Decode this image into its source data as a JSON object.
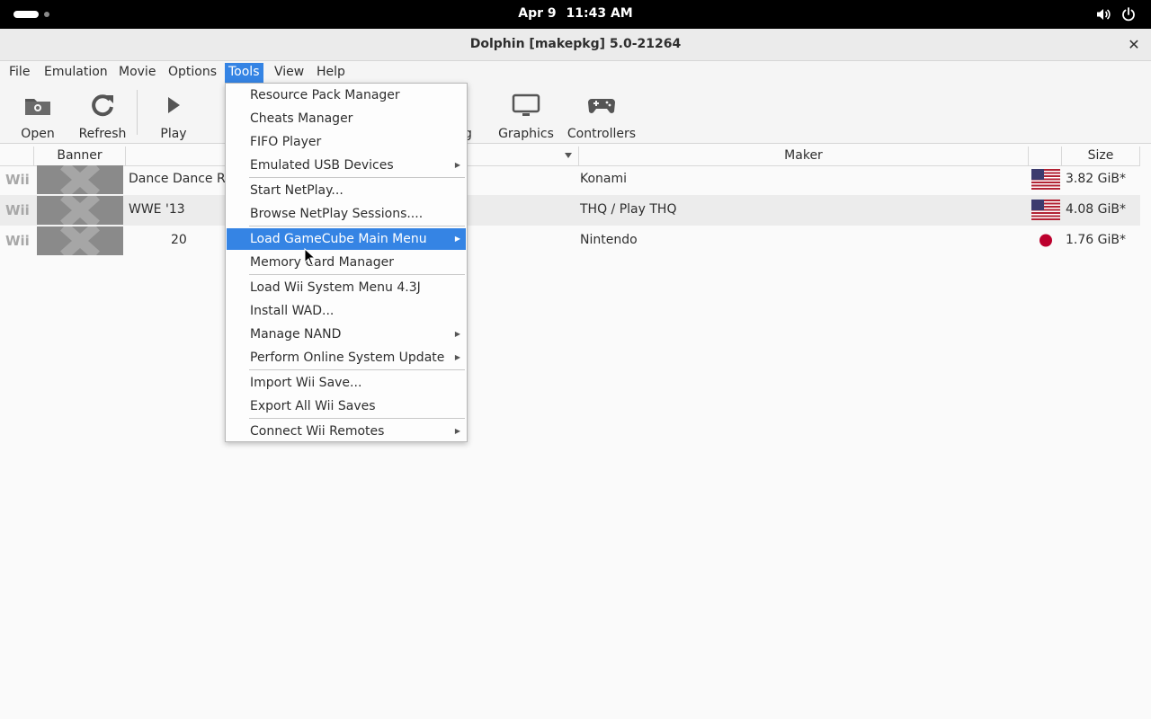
{
  "topbar": {
    "date": "Apr 9",
    "time": "11:43 AM",
    "icons": [
      "activities-pill-icon",
      "workspace-dot-icon",
      "volume-icon",
      "power-icon"
    ]
  },
  "window": {
    "title": "Dolphin [makepkg] 5.0-21264",
    "close_glyph": "✕"
  },
  "menubar": {
    "items": [
      "File",
      "Emulation",
      "Movie",
      "Options",
      "Tools",
      "View",
      "Help"
    ],
    "active": "Tools"
  },
  "toolbar": {
    "open": "Open",
    "refresh": "Refresh",
    "play": "Play",
    "config_partial": "g",
    "graphics": "Graphics",
    "controllers": "Controllers"
  },
  "table": {
    "headers": {
      "banner": "Banner",
      "maker": "Maker",
      "size": "Size"
    },
    "rows": [
      {
        "platform": "Wii",
        "title": "Dance Dance Re",
        "maker": "Konami",
        "region": "USA",
        "size": "3.82 GiB*"
      },
      {
        "platform": "Wii",
        "title": "WWE '13",
        "maker": "THQ / Play THQ",
        "region": "USA",
        "size": "4.08 GiB*"
      },
      {
        "platform": "Wii",
        "title": "20",
        "maker": "Nintendo",
        "region": "Japan",
        "size": "1.76 GiB*"
      }
    ]
  },
  "tools_menu": {
    "items": [
      {
        "label": "Resource Pack Manager",
        "submenu": false
      },
      {
        "label": "Cheats Manager",
        "submenu": false
      },
      {
        "label": "FIFO Player",
        "submenu": false
      },
      {
        "label": "Emulated USB Devices",
        "submenu": true
      },
      {
        "label": "Start NetPlay...",
        "submenu": false
      },
      {
        "label": "Browse NetPlay Sessions....",
        "submenu": false
      },
      {
        "label": "Load GameCube Main Menu",
        "submenu": true,
        "highlighted": true
      },
      {
        "label": "Memory Card Manager",
        "submenu": false
      },
      {
        "label": "Load Wii System Menu 4.3J",
        "submenu": false
      },
      {
        "label": "Install WAD...",
        "submenu": false
      },
      {
        "label": "Manage NAND",
        "submenu": true
      },
      {
        "label": "Perform Online System Update",
        "submenu": true
      },
      {
        "label": "Import Wii Save...",
        "submenu": false
      },
      {
        "label": "Export All Wii Saves",
        "submenu": false
      },
      {
        "label": "Connect Wii Remotes",
        "submenu": true
      }
    ],
    "submenu_glyph": "▶"
  },
  "colors": {
    "accent": "#3584e4",
    "topbar": "#000000",
    "banner_placeholder": "#8a8a8a",
    "japan_dot": "#bc002d"
  }
}
